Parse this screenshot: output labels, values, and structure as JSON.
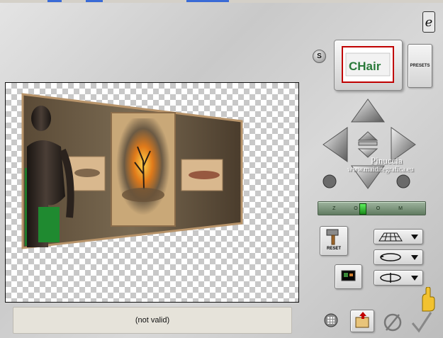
{
  "top_strip": {
    "segments": [
      "tab-1",
      "tab-2",
      "tab-3"
    ]
  },
  "status": {
    "text": "(not valid)"
  },
  "presets": {
    "button_label": "PRESETS",
    "thumbnail_text": "CHair"
  },
  "s_button": {
    "label": "S"
  },
  "logo": {
    "label": "e"
  },
  "zoom": {
    "label": "Z O O M",
    "position_fraction": 0.42
  },
  "reset": {
    "label": "RESET"
  },
  "watermark": {
    "line1": "Pinuccia",
    "line2": "www.maidiregrafica.eu"
  },
  "colors": {
    "accent_green": "#2ea32e",
    "thumb_border": "#c00000",
    "wood": "#6b5b46"
  },
  "icons": {
    "pan_up": "arrow-up-icon",
    "pan_down": "arrow-down-icon",
    "pan_left": "arrow-left-icon",
    "pan_right": "arrow-right-icon",
    "center": "center-icon",
    "rotate_left": "rotate-left-icon",
    "rotate_right": "rotate-right-icon",
    "grid": "grid-icon",
    "file": "file-icon",
    "cancel": "cancel-icon",
    "ok": "checkmark-icon",
    "hand": "pointing-hand-icon"
  }
}
